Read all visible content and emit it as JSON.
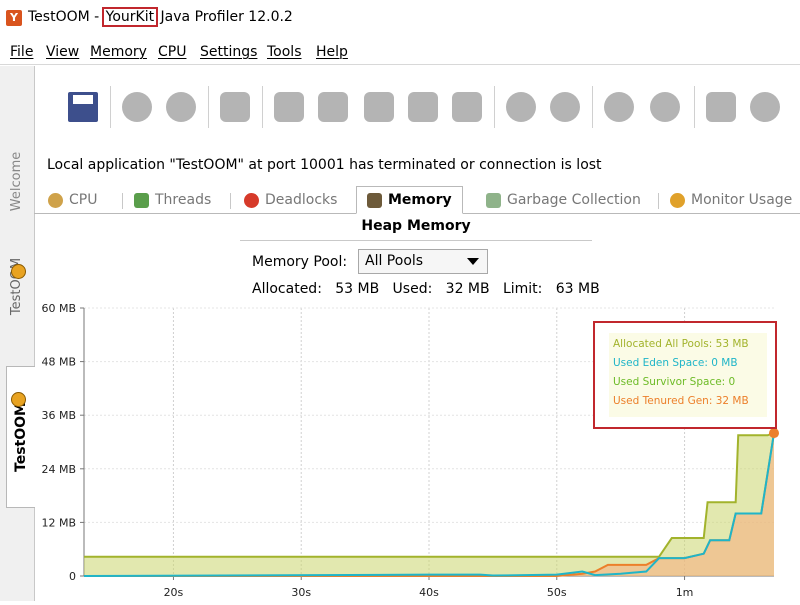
{
  "window": {
    "title_prefix": "TestOOM - ",
    "title_highlight": "YourKit",
    "title_suffix": " Java Profiler 12.0.2"
  },
  "menu": [
    "File",
    "View",
    "Memory",
    "CPU",
    "Settings",
    "Tools",
    "Help"
  ],
  "sidebar": {
    "tabs": [
      "Welcome",
      "TestOOM",
      "TestOOM"
    ]
  },
  "status_message": "Local application \"TestOOM\" at port 10001 has terminated or connection is lost",
  "tabs": [
    "CPU",
    "Threads",
    "Deadlocks",
    "Memory",
    "Garbage Collection",
    "Monitor Usage"
  ],
  "active_tab": "Memory",
  "heap": {
    "title": "Heap Memory",
    "pool_label": "Memory Pool:",
    "pool_value": "All Pools",
    "stats": "Allocated:   53 MB   Used:   32 MB   Limit:   63 MB"
  },
  "legend": [
    {
      "text": "Allocated All Pools: 53 MB",
      "color": "#a2b32c"
    },
    {
      "text": "Used Eden Space: 0 MB",
      "color": "#1fb5c8"
    },
    {
      "text": "Used Survivor Space: 0",
      "color": "#6dbb27"
    },
    {
      "text": "Used Tenured Gen: 32 MB",
      "color": "#ec7f2a"
    }
  ],
  "chart_data": {
    "type": "area",
    "y_ticks": [
      "0",
      "12 MB",
      "24 MB",
      "36 MB",
      "48 MB",
      "60 MB"
    ],
    "ylim": [
      0,
      60
    ],
    "x_ticks": [
      "20s",
      "30s",
      "40s",
      "50s",
      "1m"
    ],
    "x_tick_seconds": [
      20,
      30,
      40,
      50,
      60
    ],
    "xlim": [
      13,
      67
    ],
    "series": [
      {
        "name": "Allocated All Pools",
        "color": "#a2b32c",
        "points": [
          [
            13,
            4.3
          ],
          [
            58,
            4.3
          ],
          [
            59,
            8.5
          ],
          [
            61.5,
            8.5
          ],
          [
            61.8,
            16.5
          ],
          [
            64,
            16.5
          ],
          [
            64.2,
            31.5
          ],
          [
            66.5,
            31.5
          ],
          [
            67,
            32
          ]
        ]
      },
      {
        "name": "Used Tenured Gen",
        "color": "#ec7f2a",
        "points": [
          [
            13,
            0
          ],
          [
            50,
            0
          ],
          [
            52,
            0.5
          ],
          [
            53,
            1
          ],
          [
            54,
            2.5
          ],
          [
            57,
            2.5
          ],
          [
            58,
            4
          ],
          [
            60,
            4
          ],
          [
            61.5,
            5
          ],
          [
            62,
            8
          ],
          [
            63.5,
            8
          ],
          [
            64,
            14
          ],
          [
            66,
            14
          ],
          [
            67,
            32
          ]
        ]
      },
      {
        "name": "Used Eden Space",
        "color": "#1fb5c8",
        "points": [
          [
            13,
            0
          ],
          [
            40,
            0.3
          ],
          [
            44,
            0.3
          ],
          [
            45,
            0.1
          ],
          [
            50,
            0.3
          ],
          [
            52,
            1
          ],
          [
            53,
            0.2
          ],
          [
            55,
            0.5
          ],
          [
            57,
            1
          ],
          [
            58,
            4
          ],
          [
            60,
            4
          ],
          [
            61.5,
            5
          ],
          [
            62,
            8
          ],
          [
            63.5,
            8
          ],
          [
            64,
            14
          ],
          [
            66,
            14
          ],
          [
            67,
            32
          ]
        ]
      }
    ]
  }
}
